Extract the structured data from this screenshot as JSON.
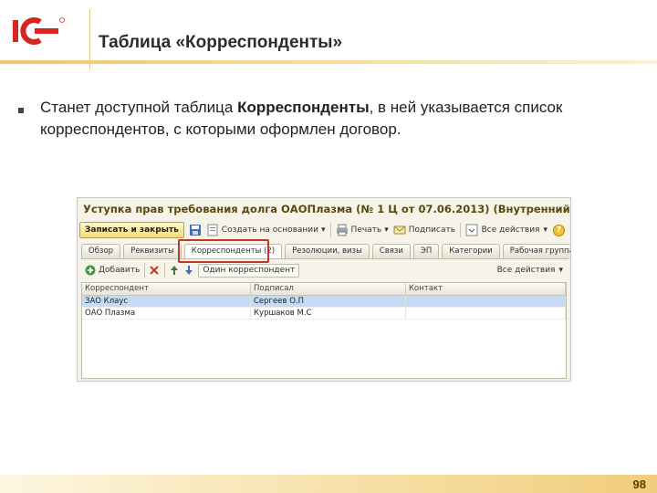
{
  "slide": {
    "title": "Таблица «Корреспонденты»",
    "bullet_before": "Станет доступной таблица ",
    "bullet_bold": "Корреспонденты",
    "bullet_after": ", в ней указывается список корреспондентов, с которыми оформлен договор.",
    "page_number": "98"
  },
  "window": {
    "title": "Уступка прав требования долга ОАОПлазма (№ 1 Ц от 07.06.2013) (Внутренний до...",
    "toolbar": {
      "save_close": "Записать и закрыть",
      "create_based": "Создать на основании",
      "print": "Печать",
      "sign": "Подписать",
      "all_actions": "Все действия",
      "help": "?"
    },
    "tabs": [
      "Обзор",
      "Реквизиты",
      "Корреспонденты (2)",
      "Резолюции, визы",
      "Связи",
      "ЭП",
      "Категории",
      "Рабочая группа"
    ],
    "subbar": {
      "add": "Добавить",
      "one_correspondent": "Один корреспондент",
      "all_actions": "Все действия"
    },
    "grid": {
      "columns": [
        "Корреспондент",
        "Подписал",
        "Контакт"
      ],
      "rows": [
        [
          "ЗАО Клаус",
          "Сергеев О.П",
          ""
        ],
        [
          "ОАО Плазма",
          "Куршаков М.С",
          ""
        ]
      ]
    }
  },
  "colors": {
    "accent": "#f2c46a",
    "highlight": "#c0392b",
    "selection": "#c7daf3",
    "logo_red": "#d6261f"
  }
}
